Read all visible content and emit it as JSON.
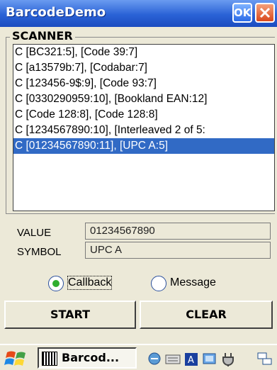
{
  "window": {
    "title": "BarcodeDemo",
    "ok_label": "OK"
  },
  "scanner": {
    "group_label": "SCANNER",
    "items": [
      "C [BC321:5], [Code 39:7]",
      "C [a13579b:7], [Codabar:7]",
      "C [123456-9$:9], [Code 93:7]",
      "C [0330290959:10], [Bookland EAN:12]",
      "C [Code 128:8], [Code 128:8]",
      "C [1234567890:10], [Interleaved 2 of 5:",
      "C [01234567890:11], [UPC A:5]"
    ],
    "selected_index": 6
  },
  "value": {
    "label": "VALUE",
    "text": "01234567890"
  },
  "symbol": {
    "label": "SYMBOL",
    "text": "UPC A"
  },
  "mode": {
    "callback_label": "Callback",
    "message_label": "Message",
    "selected": "Callback"
  },
  "buttons": {
    "start": "START",
    "clear": "CLEAR"
  },
  "taskbar": {
    "task_label": "Barcod...",
    "tray_icons": [
      "sync-icon",
      "keyboard-icon",
      "input-panel-icon",
      "network-icon",
      "power-icon",
      "wireless-icon"
    ]
  },
  "colors": {
    "titlebar": "#2a62d6",
    "selection": "#316ac5",
    "radio_check": "#2fae2f"
  }
}
